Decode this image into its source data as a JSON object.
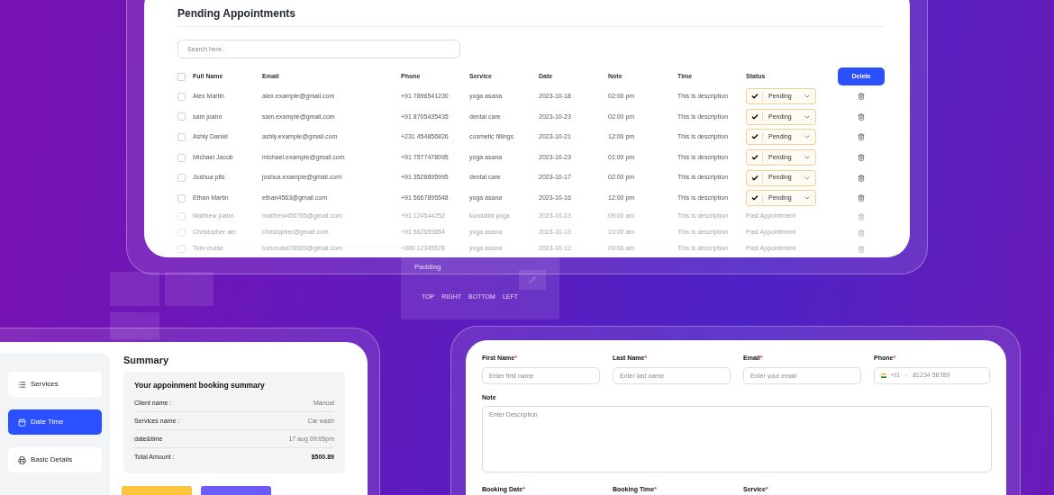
{
  "appointments_panel": {
    "title": "Pending Appointments",
    "search": {
      "placeholder": "Search here.."
    },
    "all_checked": false,
    "columns": [
      "Full Name",
      "Email",
      "Phone",
      "Service",
      "Date",
      "Note",
      "Time",
      "Status"
    ],
    "delete_button": "Delete",
    "rows": [
      {
        "kind": "pending",
        "checked": false,
        "full_name": "Alex Martin",
        "email": "alex.example@gmail.com",
        "phone": "+91 7896541230",
        "service": "yoga asana",
        "date": "2023-10-18",
        "note": "02:00 pm",
        "time": "This is description",
        "status": "Pending"
      },
      {
        "kind": "pending",
        "checked": false,
        "full_name": "sam joahn",
        "email": "sam.example@gmail.com",
        "phone": "+91 8705435435",
        "service": "dental care",
        "date": "2023-10-23",
        "note": "02:00 pm",
        "time": "This is description",
        "status": "Pending"
      },
      {
        "kind": "pending",
        "checked": false,
        "full_name": "Ashly Daniel",
        "email": "ashly.example@gmail.com",
        "phone": "+231 454856826",
        "service": "cosmetic fillings",
        "date": "2023-10-21",
        "note": "12:00 pm",
        "time": "This is description",
        "status": "Pending"
      },
      {
        "kind": "pending",
        "checked": false,
        "full_name": "Michael Jacob",
        "email": "michael.example@gmail.com",
        "phone": "+91 7577478095",
        "service": "yoga asana",
        "date": "2023-10-23",
        "note": "01:00 pm",
        "time": "This is description",
        "status": "Pending"
      },
      {
        "kind": "pending",
        "checked": false,
        "full_name": "Joshua pits",
        "email": "joshua.example@gmail.com",
        "phone": "+91 3526895995",
        "service": "dental care",
        "date": "2023-10-17",
        "note": "02:00 pm",
        "time": "This is description",
        "status": "Pending"
      },
      {
        "kind": "pending",
        "checked": false,
        "full_name": "Ethan Martin",
        "email": "ethan4563@gmail.com",
        "phone": "+91 5667895548",
        "service": "yoga asana",
        "date": "2023-10-16",
        "note": "12:00 pm",
        "time": "This is description",
        "status": "Pending"
      },
      {
        "kind": "past",
        "checked": false,
        "full_name": "Matthew joahn",
        "email": "matthew456765@gmail.com",
        "phone": "+91 124544252",
        "service": "kundalini yoga",
        "date": "2023-10-13",
        "note": "09:00 am",
        "time": "This is description",
        "status": "Past Appointment"
      },
      {
        "kind": "past",
        "checked": false,
        "full_name": "Christopher aer",
        "email": "christopher@gmail.com",
        "phone": "+91 562659854",
        "service": "yoga asana",
        "date": "2023-10-13",
        "note": "10:00 am",
        "time": "This is description",
        "status": "Past Appointment"
      },
      {
        "kind": "past",
        "checked": false,
        "full_name": "Tom cruise",
        "email": "tomcruise78920@gmail.com",
        "phone": "+389 12345678",
        "service": "yoga asana",
        "date": "2023-10-13",
        "note": "09:00 am",
        "time": "This is description",
        "status": "Past Appointment"
      }
    ]
  },
  "background_panel": {
    "label": "Padding",
    "sides": [
      "TOP",
      "RIGHT",
      "BOTTOM",
      "LEFT"
    ]
  },
  "booking_summary": {
    "nav": [
      {
        "kind": "services",
        "label": "Services",
        "selected": false
      },
      {
        "kind": "calendar",
        "label": "Date Time",
        "selected": true
      },
      {
        "kind": "details",
        "label": "Basic Details",
        "selected": false
      }
    ],
    "title": "Summary",
    "card_title": "Your appoinment booking summary",
    "lines": [
      {
        "label": "Client name :",
        "value": "Manual",
        "bold": false
      },
      {
        "label": "Services name :",
        "value": "Car wash",
        "bold": false
      },
      {
        "label": "date&time",
        "value": "17 aug 09:05pm",
        "bold": false
      },
      {
        "label": "Total Amount :",
        "value": "$500.89",
        "bold": true
      }
    ]
  },
  "booking_form": {
    "required_mark": "*",
    "fields": [
      {
        "kind": "text",
        "label": "First Name",
        "required": true,
        "placeholder": "Enter first name"
      },
      {
        "kind": "text",
        "label": "Last Name",
        "required": true,
        "placeholder": "Enter last name"
      },
      {
        "kind": "text",
        "label": "Email",
        "required": true,
        "placeholder": "Enter your email"
      },
      {
        "kind": "phone",
        "label": "Phone",
        "required": true,
        "dial_code": "+91",
        "placeholder": "81234 56789"
      }
    ],
    "note": {
      "label": "Note",
      "required": false,
      "placeholder": "Enter Description"
    },
    "next_fields": [
      {
        "label": "Booking Date",
        "required": true
      },
      {
        "label": "Booking Time",
        "required": true
      },
      {
        "label": "Service",
        "required": true
      }
    ]
  }
}
